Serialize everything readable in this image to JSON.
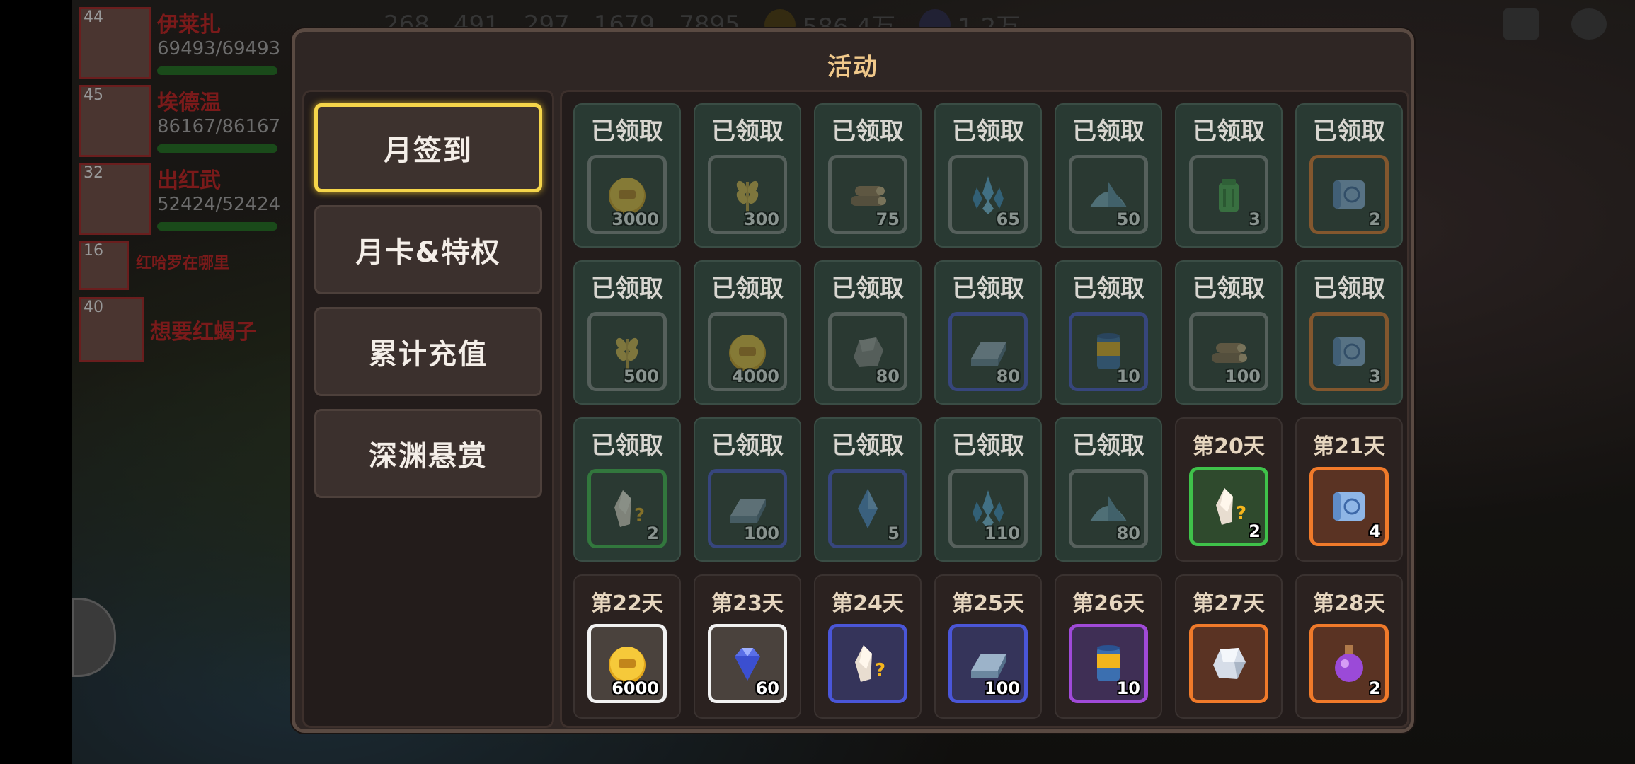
{
  "dialog": {
    "title": "活动"
  },
  "tabs": [
    {
      "label": "月签到",
      "active": true
    },
    {
      "label": "月卡&特权",
      "active": false
    },
    {
      "label": "累计充值",
      "active": false
    },
    {
      "label": "深渊悬赏",
      "active": false
    }
  ],
  "claimed_label": "已领取",
  "rewards": [
    {
      "label": "已领取",
      "state": "claimed",
      "icon": "gold-coin-icon",
      "qty": "3000",
      "border": "gray"
    },
    {
      "label": "已领取",
      "state": "claimed",
      "icon": "wheat-icon",
      "qty": "300",
      "border": "gray"
    },
    {
      "label": "已领取",
      "state": "claimed",
      "icon": "wood-logs-icon",
      "qty": "75",
      "border": "gray"
    },
    {
      "label": "已领取",
      "state": "claimed",
      "icon": "crystal-cluster-icon",
      "qty": "65",
      "border": "gray"
    },
    {
      "label": "已领取",
      "state": "claimed",
      "icon": "sand-pile-icon",
      "qty": "50",
      "border": "gray"
    },
    {
      "label": "已领取",
      "state": "claimed",
      "icon": "green-bucket-icon",
      "qty": "3",
      "border": "gray"
    },
    {
      "label": "已领取",
      "state": "claimed",
      "icon": "scroll-icon",
      "qty": "2",
      "border": "orange"
    },
    {
      "label": "已领取",
      "state": "claimed",
      "icon": "wheat-icon",
      "qty": "500",
      "border": "gray"
    },
    {
      "label": "已领取",
      "state": "claimed",
      "icon": "gold-coin-icon",
      "qty": "4000",
      "border": "gray"
    },
    {
      "label": "已领取",
      "state": "claimed",
      "icon": "stone-icon",
      "qty": "80",
      "border": "gray"
    },
    {
      "label": "已领取",
      "state": "claimed",
      "icon": "iron-ingot-icon",
      "qty": "80",
      "border": "blue"
    },
    {
      "label": "已领取",
      "state": "claimed",
      "icon": "oil-barrel-icon",
      "qty": "10",
      "border": "blue"
    },
    {
      "label": "已领取",
      "state": "claimed",
      "icon": "wood-logs-icon",
      "qty": "100",
      "border": "gray"
    },
    {
      "label": "已领取",
      "state": "claimed",
      "icon": "scroll-icon",
      "qty": "3",
      "border": "orange"
    },
    {
      "label": "已领取",
      "state": "claimed",
      "icon": "mystery-crystal-icon",
      "qty": "2",
      "border": "green"
    },
    {
      "label": "已领取",
      "state": "claimed",
      "icon": "iron-ingot-icon",
      "qty": "100",
      "border": "blue"
    },
    {
      "label": "已领取",
      "state": "claimed",
      "icon": "blue-shard-icon",
      "qty": "5",
      "border": "blue"
    },
    {
      "label": "已领取",
      "state": "claimed",
      "icon": "crystal-cluster-icon",
      "qty": "110",
      "border": "gray"
    },
    {
      "label": "已领取",
      "state": "claimed",
      "icon": "sand-pile-icon",
      "qty": "80",
      "border": "gray"
    },
    {
      "label": "第20天",
      "state": "future",
      "icon": "mystery-crystal-icon",
      "qty": "2",
      "border": "green"
    },
    {
      "label": "第21天",
      "state": "future",
      "icon": "scroll-icon",
      "qty": "4",
      "border": "orange"
    },
    {
      "label": "第22天",
      "state": "future",
      "icon": "gold-coin-icon",
      "qty": "6000",
      "border": "white"
    },
    {
      "label": "第23天",
      "state": "future",
      "icon": "diamond-icon",
      "qty": "60",
      "border": "white"
    },
    {
      "label": "第24天",
      "state": "future",
      "icon": "mystery-crystal-icon",
      "qty": "",
      "border": "blue"
    },
    {
      "label": "第25天",
      "state": "future",
      "icon": "iron-ingot-icon",
      "qty": "100",
      "border": "blue"
    },
    {
      "label": "第26天",
      "state": "future",
      "icon": "oil-barrel-icon",
      "qty": "10",
      "border": "purple"
    },
    {
      "label": "第27天",
      "state": "future",
      "icon": "silver-ore-icon",
      "qty": "",
      "border": "orange"
    },
    {
      "label": "第28天",
      "state": "future",
      "icon": "potion-icon",
      "qty": "2",
      "border": "orange"
    }
  ],
  "background": {
    "resources": [
      "268",
      "491",
      "297",
      "1679",
      "7895",
      "586.4万",
      "1.2万"
    ],
    "party": [
      {
        "level": "44",
        "name": "伊莱扎",
        "hp": "69493/69493"
      },
      {
        "level": "45",
        "name": "埃德温",
        "hp": "86167/86167"
      },
      {
        "level": "32",
        "name": "出红武",
        "hp": "52424/52424"
      },
      {
        "level": "16",
        "name": "红哈罗在哪里"
      },
      {
        "level": "40",
        "name": "想要红蝎子"
      }
    ]
  },
  "colors": {
    "active_tab_border": "#f5d54a",
    "claimed_cell_bg": "#293a33",
    "title": "#f0c88a"
  }
}
